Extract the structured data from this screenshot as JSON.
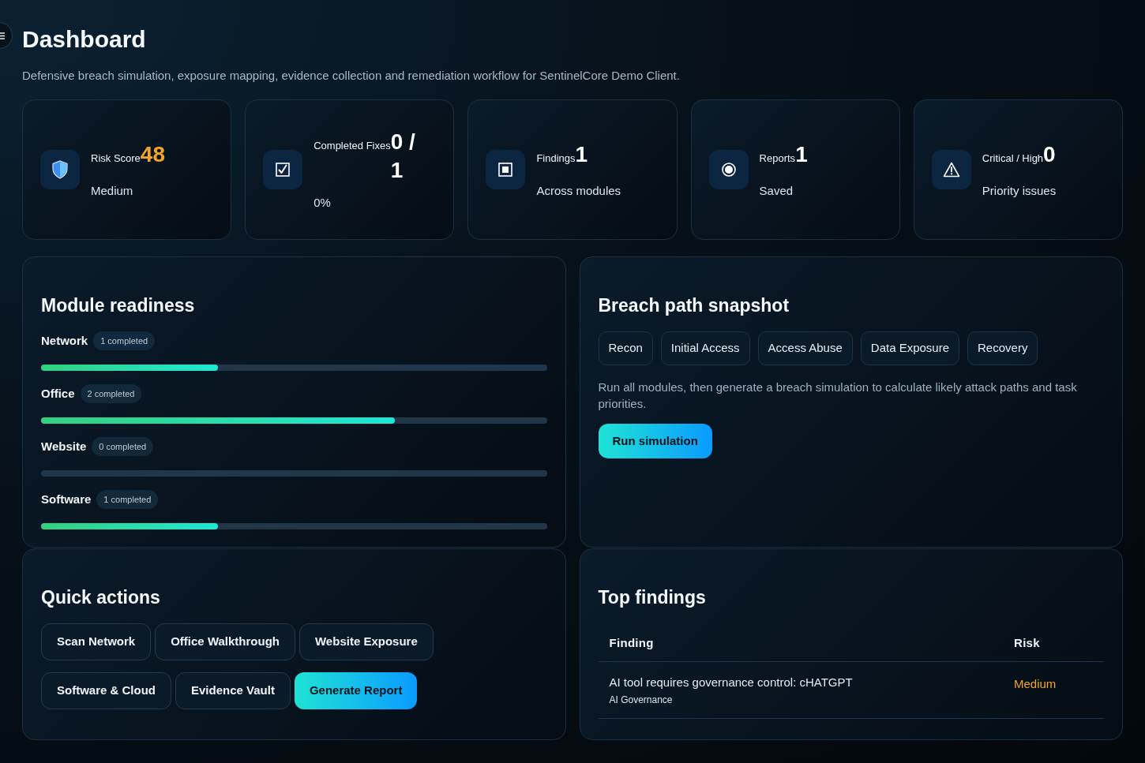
{
  "header": {
    "title": "Dashboard",
    "subtitle": "Defensive breach simulation, exposure mapping, evidence collection and remediation workflow for SentinelCore Demo Client."
  },
  "stats": [
    {
      "label": "Risk Score",
      "value": "48",
      "note": "Medium",
      "color": "#f5a524"
    },
    {
      "label": "Completed Fixes",
      "value": "0 / 1",
      "note": "0%",
      "color": "#ffffff"
    },
    {
      "label": "Findings",
      "value": "1",
      "note": "Across modules",
      "color": "#ffffff"
    },
    {
      "label": "Reports",
      "value": "1",
      "note": "Saved",
      "color": "#ffffff"
    },
    {
      "label": "Critical / High",
      "value": "0",
      "note": "Priority issues",
      "color": "#ffffff"
    }
  ],
  "module_readiness": {
    "title": "Module readiness",
    "modules": [
      {
        "name": "Network",
        "badge": "1 completed",
        "level": 0.35
      },
      {
        "name": "Office",
        "badge": "2 completed",
        "level": 0.7
      },
      {
        "name": "Website",
        "badge": "0 completed",
        "level": 0
      },
      {
        "name": "Software",
        "badge": "1 completed",
        "level": 0.35
      }
    ]
  },
  "breach_path": {
    "title": "Breach path snapshot",
    "stages": [
      "Recon",
      "Initial Access",
      "Access Abuse",
      "Data Exposure",
      "Recovery"
    ],
    "description": "Run all modules, then generate a breach simulation to calculate likely attack paths and task priorities.",
    "button": "Run simulation"
  },
  "quick_actions": {
    "title": "Quick actions",
    "buttons": [
      {
        "label": "Scan Network",
        "kind": "outline"
      },
      {
        "label": "Office Walkthrough",
        "kind": "outline"
      },
      {
        "label": "Website Exposure",
        "kind": "outline"
      },
      {
        "label": "Software & Cloud",
        "kind": "outline"
      },
      {
        "label": "Evidence Vault",
        "kind": "outline"
      },
      {
        "label": "Generate Report",
        "kind": "primary"
      }
    ]
  },
  "top_findings": {
    "title": "Top findings",
    "columns": [
      "Finding",
      "Risk"
    ],
    "rows": [
      {
        "finding": "AI tool requires governance control: cHATGPT",
        "category": "AI Governance",
        "risk": "Medium",
        "color": "#f5a524"
      }
    ]
  }
}
